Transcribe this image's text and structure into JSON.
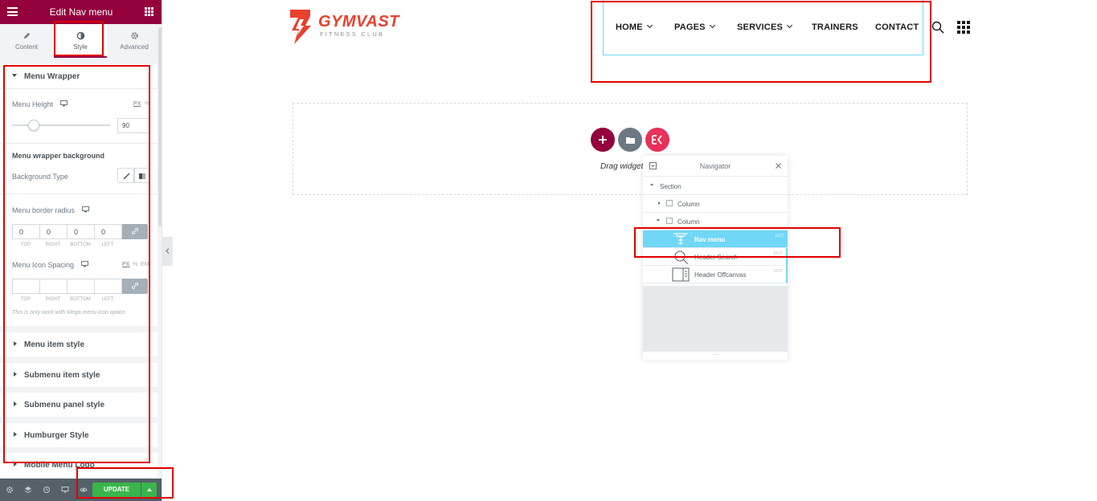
{
  "panel": {
    "title": "Edit Nav menu",
    "tabs": [
      {
        "label": "Content",
        "icon": "pencil-icon"
      },
      {
        "label": "Style",
        "icon": "half-circle-icon"
      },
      {
        "label": "Advanced",
        "icon": "gear-icon"
      }
    ],
    "active_tab": "Style",
    "menu_wrapper": {
      "title": "Menu Wrapper",
      "menu_height_label": "Menu Height",
      "units": [
        "PX",
        "%"
      ],
      "menu_height_value": "90",
      "menu_height_slider_fraction": 0.22,
      "background_heading": "Menu wrapper background",
      "background_type_label": "Background Type",
      "border_radius_label": "Menu border radius",
      "border_radius_values": [
        "0",
        "0",
        "0",
        "0"
      ],
      "dimension_labels": [
        "TOP",
        "RIGHT",
        "BOTTOM",
        "LEFT"
      ],
      "icon_spacing_label": "Menu Icon Spacing",
      "icon_spacing_units": [
        "PX",
        "%",
        "EM"
      ],
      "icon_spacing_values": [
        "",
        "",
        "",
        ""
      ],
      "note": "This is only work with Mega menu icon option"
    },
    "sections": [
      "Menu item style",
      "Submenu item style",
      "Submenu panel style",
      "Humburger Style",
      "Mobile Menu Logo"
    ],
    "update_label": "UPDATE"
  },
  "site": {
    "logo_name": "GYMVAST",
    "logo_tagline": "FITNESS CLUB",
    "logo_color": "#e8412c",
    "nav": [
      {
        "label": "HOME",
        "dropdown": true
      },
      {
        "label": "PAGES",
        "dropdown": true
      },
      {
        "label": "SERVICES",
        "dropdown": true
      },
      {
        "label": "TRAINERS",
        "dropdown": false
      },
      {
        "label": "CONTACT",
        "dropdown": false
      }
    ]
  },
  "canvas": {
    "drag_text": "Drag widget"
  },
  "navigator": {
    "title": "Navigator",
    "rows": [
      {
        "label": "Section"
      },
      {
        "label": "Column"
      },
      {
        "label": "Column"
      },
      {
        "label": "Nav menu",
        "edit": "EDIT"
      },
      {
        "label": "Header Search",
        "edit": "EDIT"
      },
      {
        "label": "Header Offcanvas",
        "edit": "EDIT"
      }
    ],
    "footer": "..."
  },
  "colors": {
    "brand": "#93003c",
    "update": "#39b54a",
    "highlight": "#e00000",
    "selected_row": "#71d7f7"
  }
}
